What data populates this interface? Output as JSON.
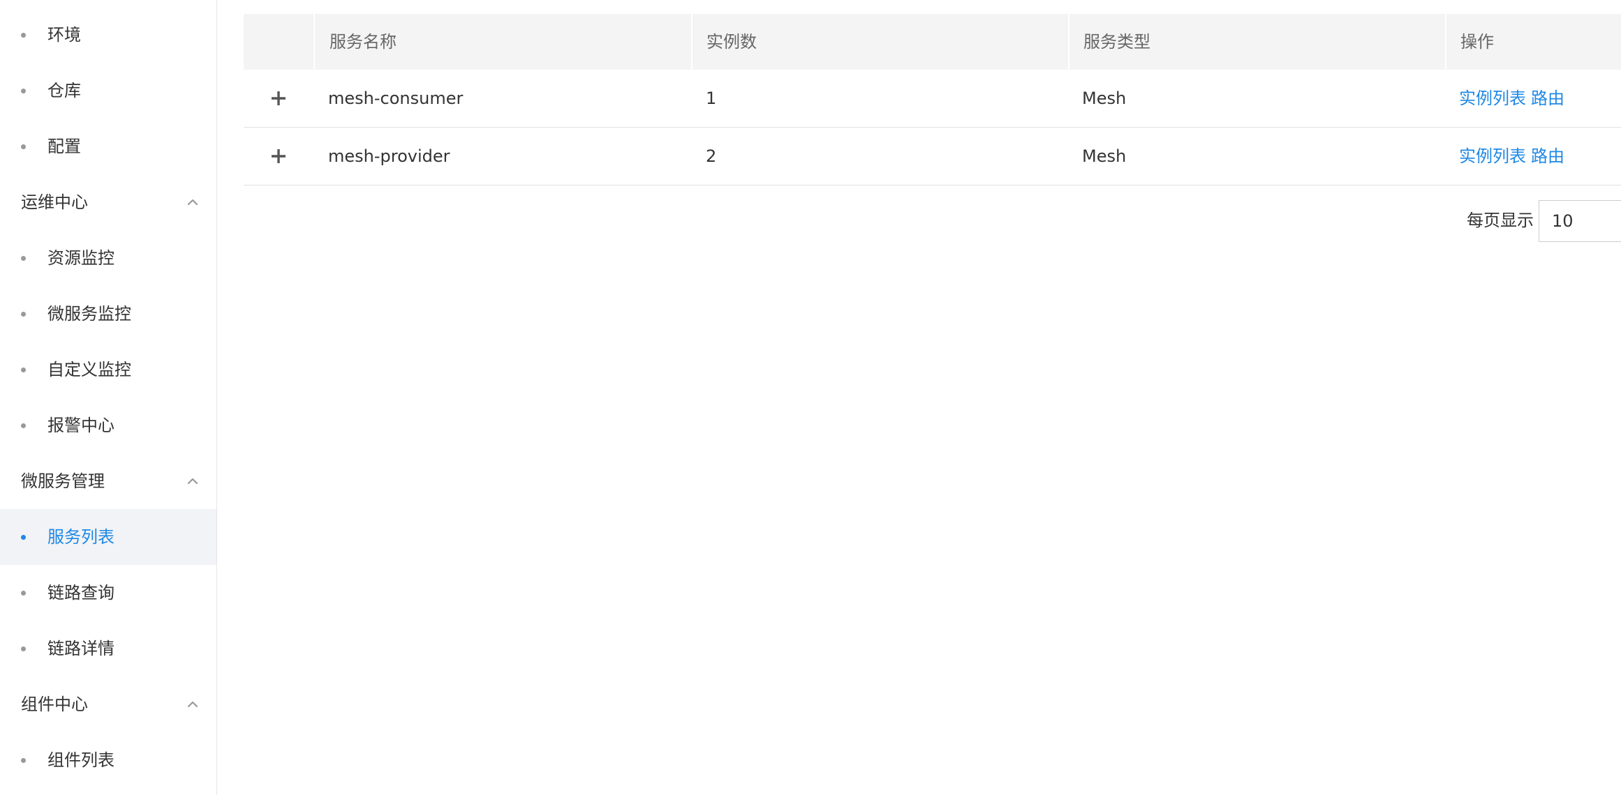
{
  "sidebar": {
    "items": [
      {
        "type": "item",
        "label": "环境"
      },
      {
        "type": "item",
        "label": "仓库"
      },
      {
        "type": "item",
        "label": "配置"
      },
      {
        "type": "group",
        "label": "运维中心"
      },
      {
        "type": "item",
        "label": "资源监控"
      },
      {
        "type": "item",
        "label": "微服务监控"
      },
      {
        "type": "item",
        "label": "自定义监控"
      },
      {
        "type": "item",
        "label": "报警中心"
      },
      {
        "type": "group",
        "label": "微服务管理"
      },
      {
        "type": "item",
        "label": "服务列表",
        "active": true
      },
      {
        "type": "item",
        "label": "链路查询"
      },
      {
        "type": "item",
        "label": "链路详情"
      },
      {
        "type": "group",
        "label": "组件中心"
      },
      {
        "type": "item",
        "label": "组件列表"
      }
    ]
  },
  "table": {
    "headers": [
      "服务名称",
      "实例数",
      "服务类型",
      "操作"
    ],
    "rows": [
      {
        "name": "mesh-consumer",
        "instances": "1",
        "type": "Mesh",
        "actions": [
          "实例列表",
          "路由"
        ]
      },
      {
        "name": "mesh-provider",
        "instances": "2",
        "type": "Mesh",
        "actions": [
          "实例列表",
          "路由"
        ]
      }
    ]
  },
  "pagination": {
    "page_size_label": "每页显示",
    "page_size_value": "10"
  },
  "colors": {
    "accent": "#1e88e5",
    "header_bg": "#f4f4f4",
    "active_item_bg": "#f2f3f7"
  },
  "icons": {
    "expand": "plus-icon",
    "collapse_group": "chevron-up-icon",
    "bullet": "dot-icon"
  }
}
